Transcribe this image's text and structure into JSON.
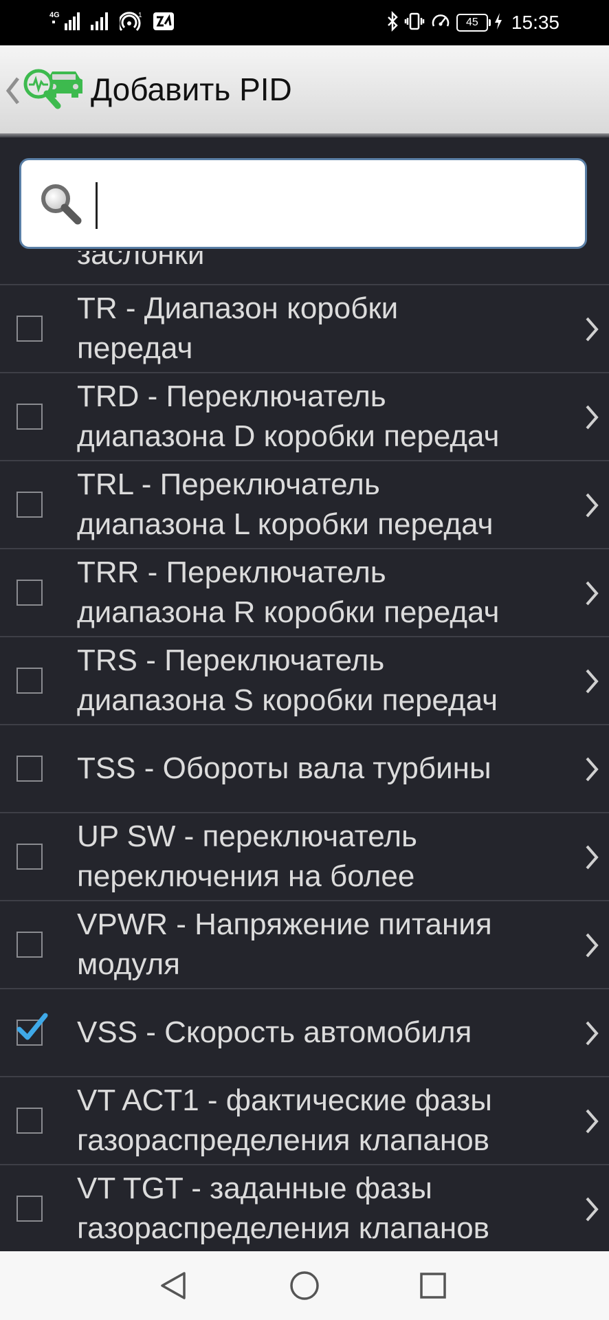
{
  "status_bar": {
    "network_label": "4G",
    "sim2_label": "1",
    "battery_level": "45",
    "time": "15:35"
  },
  "action_bar": {
    "title": "Добавить PID",
    "icon": "car-diagnostics-icon"
  },
  "search": {
    "value": "",
    "placeholder": ""
  },
  "list": {
    "partial_item_label": "заслонки",
    "items": [
      {
        "label": "TR - Диапазон коробки\nпередач",
        "checked": false
      },
      {
        "label": "TRD - Переключатель\nдиапазона D коробки передач",
        "checked": false
      },
      {
        "label": "TRL - Переключатель\nдиапазона L коробки передач",
        "checked": false
      },
      {
        "label": "TRR - Переключатель\nдиапазона R коробки передач",
        "checked": false
      },
      {
        "label": "TRS - Переключатель\nдиапазона S коробки передач",
        "checked": false
      },
      {
        "label": "TSS - Обороты вала турбины",
        "checked": false
      },
      {
        "label": "UP SW - переключатель\nпереключения на более",
        "checked": false
      },
      {
        "label": "VPWR - Напряжение питания\nмодуля",
        "checked": false
      },
      {
        "label": "VSS - Скорость автомобиля",
        "checked": true
      },
      {
        "label": "VT ACT1 - фактические фазы\nгазораспределения клапанов",
        "checked": false
      },
      {
        "label": "VT TGT - заданные фазы\nгазораспределения клапанов",
        "checked": false
      }
    ]
  },
  "nav_bar": {
    "back": "back-triangle-icon",
    "home": "home-circle-icon",
    "recents": "recents-square-icon"
  },
  "colors": {
    "list_background": "#24252c",
    "check_accent": "#3fa9e8",
    "icon_green": "#3dba4e"
  }
}
